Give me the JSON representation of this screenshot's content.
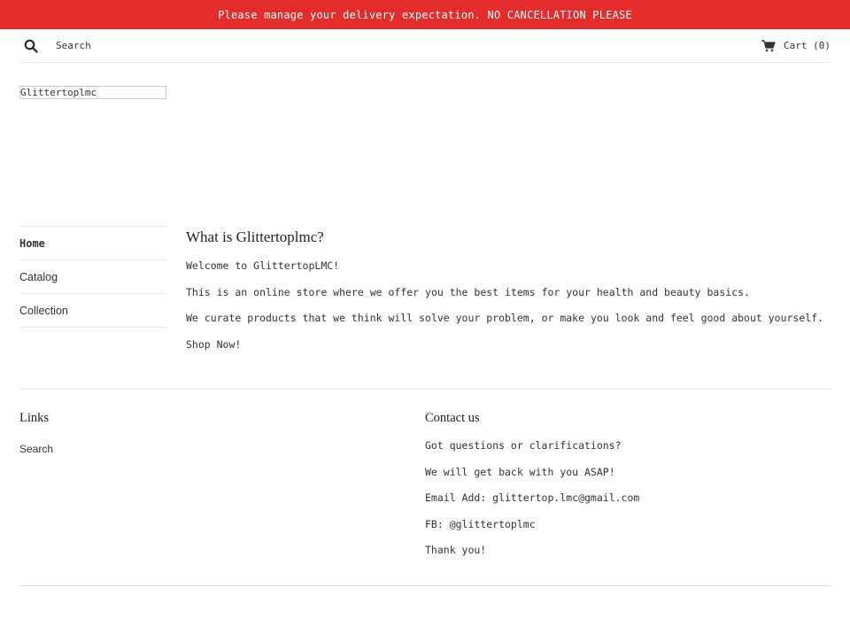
{
  "announcement": "Please manage your delivery expectation. NO CANCELLATION PLEASE",
  "header": {
    "search_placeholder": "Search",
    "search_icon": "search-icon",
    "cart_label": "Cart (0)",
    "cart_icon": "cart-icon"
  },
  "logo": {
    "alt_text": "Glittertoplmc"
  },
  "sidenav": {
    "items": [
      {
        "label": "Home",
        "active": true
      },
      {
        "label": "Catalog",
        "active": false
      },
      {
        "label": "Collection",
        "active": false
      }
    ]
  },
  "content": {
    "title": "What is Glittertoplmc?",
    "paragraphs": [
      "Welcome to GlittertopLMC!",
      "This is an online store where we offer you the best items for your health and beauty basics.",
      "We curate products that we think will solve your problem, or make you look and feel good about yourself.",
      "Shop Now!"
    ]
  },
  "footer": {
    "links": {
      "heading": "Links",
      "items": [
        "Search"
      ]
    },
    "contact": {
      "heading": "Contact us",
      "lines": [
        "Got questions or clarifications?",
        "We will get back with you ASAP!",
        "Email Add: glittertop.lmc@gmail.com",
        "FB: @glittertoplmc",
        "Thank you!"
      ]
    }
  },
  "colors": {
    "announcement_bg": "#e32c2b",
    "text": "#333333",
    "divider": "#e8e8e8"
  }
}
